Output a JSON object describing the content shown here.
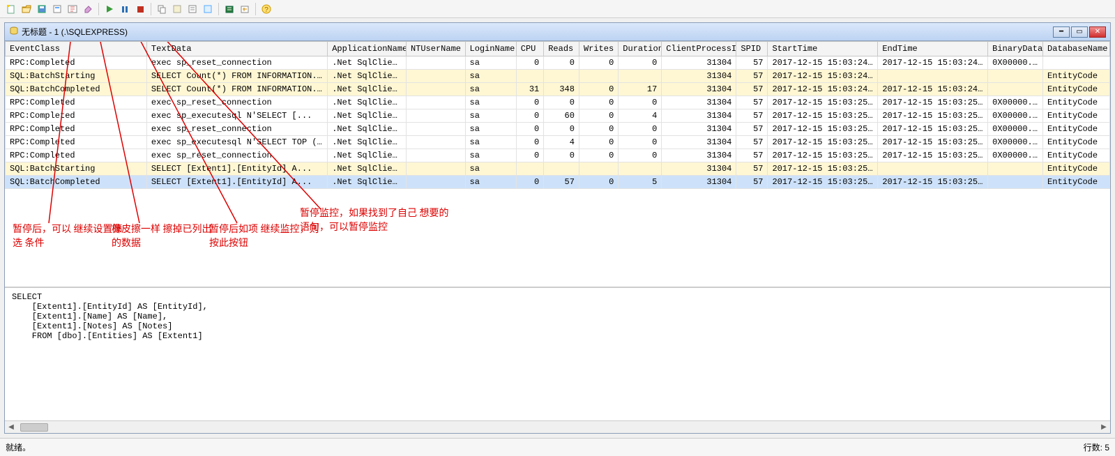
{
  "window_title": "无标题 - 1 (.\\SQLEXPRESS)",
  "toolbar_icons": [
    "new-trace",
    "open",
    "save",
    "save-as",
    "properties",
    "eraser",
    "sep",
    "play",
    "pause",
    "stop",
    "sep",
    "copy",
    "template",
    "select",
    "window",
    "sep",
    "export",
    "aggregate",
    "sep",
    "help"
  ],
  "columns": [
    "EventClass",
    "TextData",
    "ApplicationName",
    "NTUserName",
    "LoginName",
    "CPU",
    "Reads",
    "Writes",
    "Duration",
    "ClientProcessID",
    "SPID",
    "StartTime",
    "EndTime",
    "BinaryData",
    "DatabaseName"
  ],
  "rows": [
    {
      "cls": "RPC:Completed",
      "txt": "exec sp_reset_connection",
      "app": ".Net SqlClie...",
      "nt": "",
      "login": "sa",
      "cpu": "0",
      "reads": "0",
      "writes": "0",
      "dur": "0",
      "cpid": "31304",
      "spid": "57",
      "start": "2017-12-15 15:03:24...",
      "end": "2017-12-15 15:03:24...",
      "bin": "0X00000...",
      "db": "",
      "type": "rpc"
    },
    {
      "cls": "SQL:BatchStarting",
      "txt": "  SELECT Count(*)   FROM INFORMATION...",
      "app": ".Net SqlClie...",
      "nt": "",
      "login": "sa",
      "cpu": "",
      "reads": "",
      "writes": "",
      "dur": "",
      "cpid": "31304",
      "spid": "57",
      "start": "2017-12-15 15:03:24...",
      "end": "",
      "bin": "",
      "db": "EntityCode",
      "type": "sql"
    },
    {
      "cls": "SQL:BatchCompleted",
      "txt": "  SELECT Count(*)   FROM INFORMATION...",
      "app": ".Net SqlClie...",
      "nt": "",
      "login": "sa",
      "cpu": "31",
      "reads": "348",
      "writes": "0",
      "dur": "17",
      "cpid": "31304",
      "spid": "57",
      "start": "2017-12-15 15:03:24...",
      "end": "2017-12-15 15:03:24...",
      "bin": "",
      "db": "EntityCode",
      "type": "sql"
    },
    {
      "cls": "RPC:Completed",
      "txt": "exec sp_reset_connection",
      "app": ".Net SqlClie...",
      "nt": "",
      "login": "sa",
      "cpu": "0",
      "reads": "0",
      "writes": "0",
      "dur": "0",
      "cpid": "31304",
      "spid": "57",
      "start": "2017-12-15 15:03:25...",
      "end": "2017-12-15 15:03:25...",
      "bin": "0X00000...",
      "db": "EntityCode",
      "type": "rpc"
    },
    {
      "cls": "RPC:Completed",
      "txt": "exec sp_executesql N'SELECT      [...",
      "app": ".Net SqlClie...",
      "nt": "",
      "login": "sa",
      "cpu": "0",
      "reads": "60",
      "writes": "0",
      "dur": "4",
      "cpid": "31304",
      "spid": "57",
      "start": "2017-12-15 15:03:25...",
      "end": "2017-12-15 15:03:25...",
      "bin": "0X00000...",
      "db": "EntityCode",
      "type": "rpc"
    },
    {
      "cls": "RPC:Completed",
      "txt": "exec sp_reset_connection",
      "app": ".Net SqlClie...",
      "nt": "",
      "login": "sa",
      "cpu": "0",
      "reads": "0",
      "writes": "0",
      "dur": "0",
      "cpid": "31304",
      "spid": "57",
      "start": "2017-12-15 15:03:25...",
      "end": "2017-12-15 15:03:25...",
      "bin": "0X00000...",
      "db": "EntityCode",
      "type": "rpc"
    },
    {
      "cls": "RPC:Completed",
      "txt": "exec sp_executesql N'SELECT TOP (1)...",
      "app": ".Net SqlClie...",
      "nt": "",
      "login": "sa",
      "cpu": "0",
      "reads": "4",
      "writes": "0",
      "dur": "0",
      "cpid": "31304",
      "spid": "57",
      "start": "2017-12-15 15:03:25...",
      "end": "2017-12-15 15:03:25...",
      "bin": "0X00000...",
      "db": "EntityCode",
      "type": "rpc"
    },
    {
      "cls": "RPC:Completed",
      "txt": "exec sp_reset_connection",
      "app": ".Net SqlClie...",
      "nt": "",
      "login": "sa",
      "cpu": "0",
      "reads": "0",
      "writes": "0",
      "dur": "0",
      "cpid": "31304",
      "spid": "57",
      "start": "2017-12-15 15:03:25...",
      "end": "2017-12-15 15:03:25...",
      "bin": "0X00000...",
      "db": "EntityCode",
      "type": "rpc"
    },
    {
      "cls": "SQL:BatchStarting",
      "txt": "SELECT      [Extent1].[EntityId] A...",
      "app": ".Net SqlClie...",
      "nt": "",
      "login": "sa",
      "cpu": "",
      "reads": "",
      "writes": "",
      "dur": "",
      "cpid": "31304",
      "spid": "57",
      "start": "2017-12-15 15:03:25...",
      "end": "",
      "bin": "",
      "db": "EntityCode",
      "type": "sql"
    },
    {
      "cls": "SQL:BatchCompleted",
      "txt": "SELECT      [Extent1].[EntityId] A...",
      "app": ".Net SqlClie...",
      "nt": "",
      "login": "sa",
      "cpu": "0",
      "reads": "57",
      "writes": "0",
      "dur": "5",
      "cpid": "31304",
      "spid": "57",
      "start": "2017-12-15 15:03:25...",
      "end": "2017-12-15 15:03:25...",
      "bin": "",
      "db": "EntityCode",
      "type": "sel"
    }
  ],
  "annotations": {
    "a1": "暂停后，可以\n继续设置筛选\n条件",
    "a2": "橡皮擦一样\n擦掉已列出\n的数据",
    "a3": "暂停后如项\n继续监控，则\n按此按钮",
    "a4": "暂停监控，如果找到了自己\n想要的语句，可以暂停监控"
  },
  "detail_sql": "SELECT\n    [Extent1].[EntityId] AS [EntityId],\n    [Extent1].[Name] AS [Name],\n    [Extent1].[Notes] AS [Notes]\n    FROM [dbo].[Entities] AS [Extent1]",
  "status_left": "就绪。",
  "status_right": "行数: 5"
}
